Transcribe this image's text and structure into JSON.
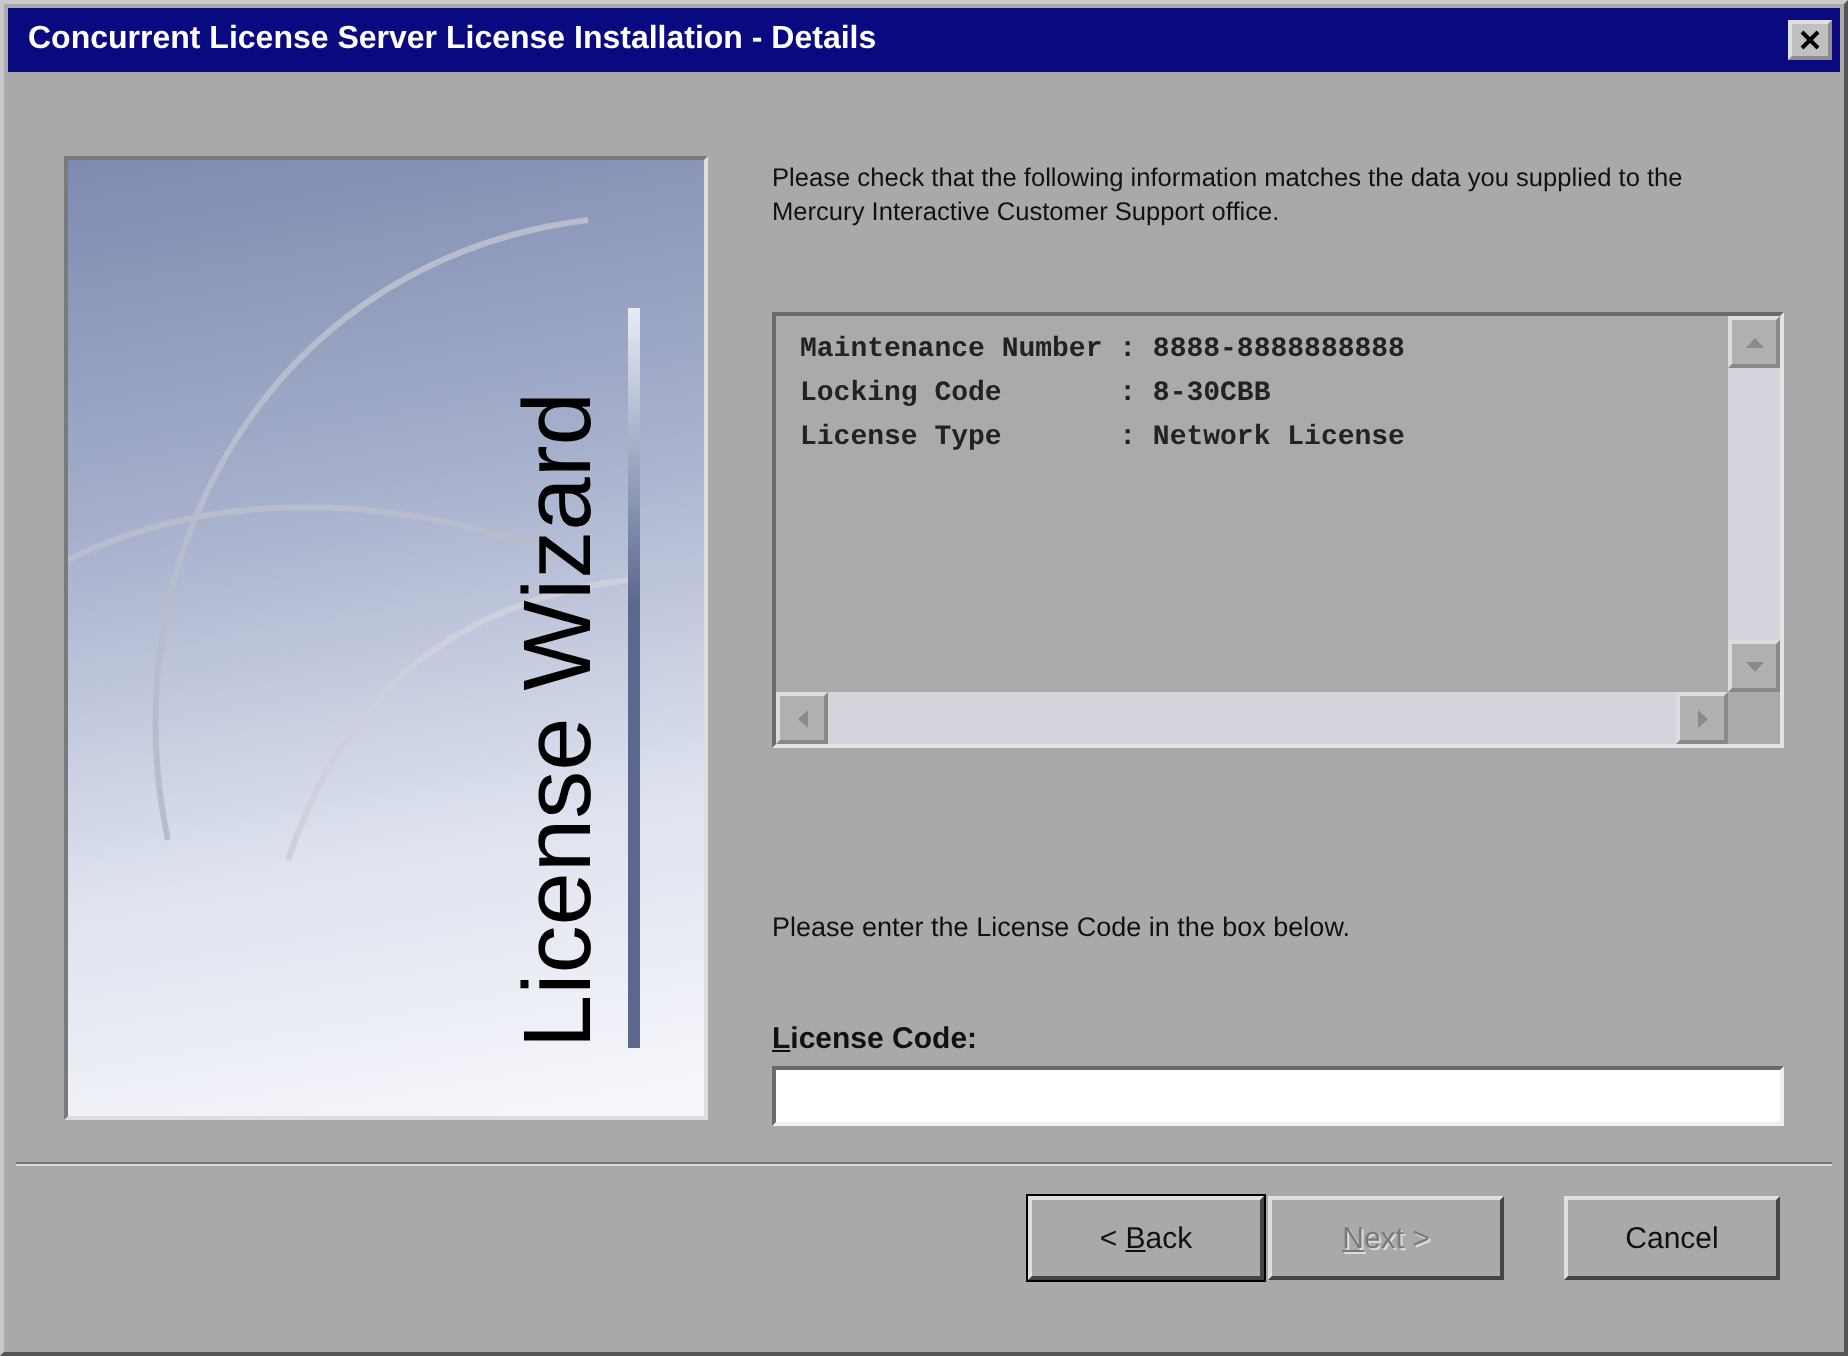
{
  "window": {
    "title": "Concurrent License Server License Installation - Details"
  },
  "banner": {
    "title": "License Wizard"
  },
  "intro": "Please check that the following information matches the data you supplied to the Mercury Interactive Customer Support office.",
  "details": {
    "lines": [
      "Maintenance Number : 8888-8888888888",
      "Locking Code       : 8-30CBB",
      "License Type       : Network License"
    ]
  },
  "prompt": "Please enter the License Code in the box below.",
  "license_code": {
    "mnemonic": "L",
    "after": "icense Code:"
  },
  "buttons": [
    {
      "before": "< ",
      "mnemonic": "B",
      "after": "ack",
      "disabled": false,
      "default": true
    },
    {
      "mnemonic": "N",
      "after": "ext >",
      "disabled": true,
      "default": false
    },
    {
      "label": "Cancel",
      "disabled": false,
      "default": false
    }
  ]
}
